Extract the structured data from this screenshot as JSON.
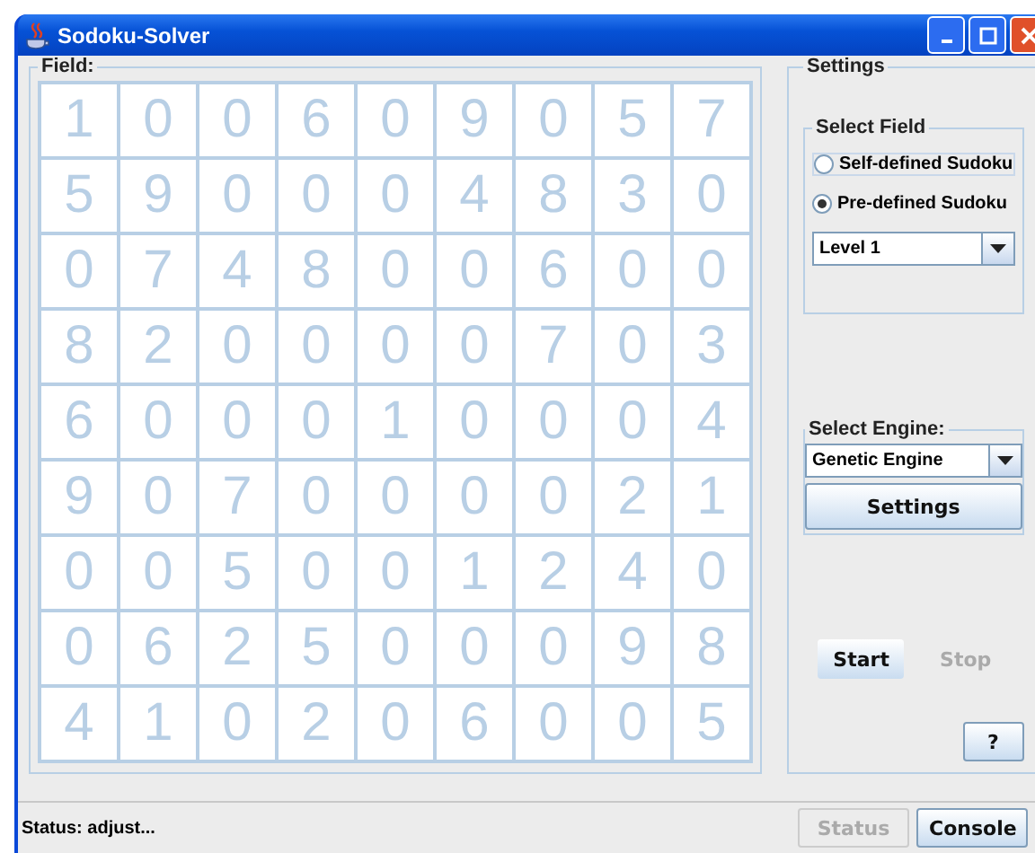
{
  "window": {
    "title": "Sodoku-Solver"
  },
  "field": {
    "title": "Field:",
    "rows": [
      [
        "1",
        "0",
        "0",
        "6",
        "0",
        "9",
        "0",
        "5",
        "7"
      ],
      [
        "5",
        "9",
        "0",
        "0",
        "0",
        "4",
        "8",
        "3",
        "0"
      ],
      [
        "0",
        "7",
        "4",
        "8",
        "0",
        "0",
        "6",
        "0",
        "0"
      ],
      [
        "8",
        "2",
        "0",
        "0",
        "0",
        "0",
        "7",
        "0",
        "3"
      ],
      [
        "6",
        "0",
        "0",
        "0",
        "1",
        "0",
        "0",
        "0",
        "4"
      ],
      [
        "9",
        "0",
        "7",
        "0",
        "0",
        "0",
        "0",
        "2",
        "1"
      ],
      [
        "0",
        "0",
        "5",
        "0",
        "0",
        "1",
        "2",
        "4",
        "0"
      ],
      [
        "0",
        "6",
        "2",
        "5",
        "0",
        "0",
        "0",
        "9",
        "8"
      ],
      [
        "4",
        "1",
        "0",
        "2",
        "0",
        "6",
        "0",
        "0",
        "5"
      ]
    ]
  },
  "settings": {
    "title": "Settings",
    "select_field": {
      "title": "Select Field",
      "options": [
        {
          "label": "Self-defined Sudoku",
          "selected": false
        },
        {
          "label": "Pre-defined Sudoku",
          "selected": true
        }
      ],
      "level": "Level 1"
    },
    "select_engine": {
      "title": "Select Engine:",
      "engine": "Genetic Engine",
      "settings_button": "Settings"
    },
    "buttons": [
      {
        "label": "Start",
        "disabled": false
      },
      {
        "label": "Stop",
        "disabled": true
      }
    ],
    "help_button": "?"
  },
  "status_bar": {
    "text": "Status: adjust...",
    "buttons": [
      {
        "label": "Status",
        "disabled": true
      },
      {
        "label": "Console",
        "disabled": false
      }
    ]
  }
}
